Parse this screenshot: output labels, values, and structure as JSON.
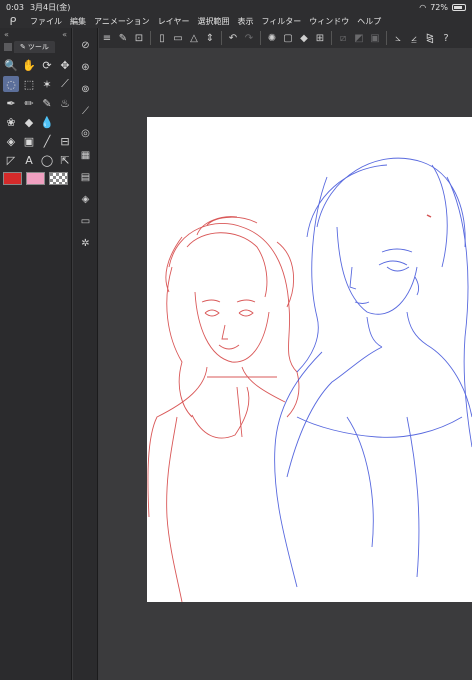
{
  "status_bar": {
    "time": "0:03",
    "date": "3月4日(金)",
    "wifi_icon": "wifi-icon",
    "battery": "72%"
  },
  "menu": {
    "logo_icon": "clip-studio-logo-icon",
    "items": [
      "ファイル",
      "編集",
      "アニメーション",
      "レイヤー",
      "選択範囲",
      "表示",
      "フィルター",
      "ウィンドウ",
      "ヘルプ"
    ]
  },
  "tool_panel": {
    "collapse_left": "«",
    "collapse_right": "«",
    "tab_label": "ツール",
    "tools": [
      {
        "name": "zoom",
        "glyph": "🔍"
      },
      {
        "name": "hand",
        "glyph": "✋"
      },
      {
        "name": "rotate",
        "glyph": "⟳"
      },
      {
        "name": "move",
        "glyph": "✥"
      },
      {
        "name": "lasso",
        "glyph": "◌",
        "selected": true
      },
      {
        "name": "select",
        "glyph": "⬚"
      },
      {
        "name": "magic-wand",
        "glyph": "✶"
      },
      {
        "name": "eyedropper",
        "glyph": "⟋"
      },
      {
        "name": "pen",
        "glyph": "✒"
      },
      {
        "name": "pencil",
        "glyph": "✏"
      },
      {
        "name": "brush",
        "glyph": "✎"
      },
      {
        "name": "airbrush",
        "glyph": "♨"
      },
      {
        "name": "decoration",
        "glyph": "❀"
      },
      {
        "name": "eraser",
        "glyph": "◆"
      },
      {
        "name": "blend",
        "glyph": "💧"
      },
      {
        "name": "spacer",
        "glyph": ""
      },
      {
        "name": "fill",
        "glyph": "◈"
      },
      {
        "name": "gradient",
        "glyph": "▣"
      },
      {
        "name": "line",
        "glyph": "╱"
      },
      {
        "name": "frame",
        "glyph": "⊟"
      },
      {
        "name": "ruler",
        "glyph": "◸"
      },
      {
        "name": "text",
        "glyph": "A"
      },
      {
        "name": "balloon",
        "glyph": "◯"
      },
      {
        "name": "object",
        "glyph": "⇱"
      }
    ],
    "colors": {
      "main": "#d42a2a",
      "sub": "#f0a0c0"
    }
  },
  "side_icons": [
    "navigator-icon",
    "sub-tool-icon",
    "tool-property-icon",
    "brush-size-icon",
    "color-wheel-icon",
    "color-set-icon",
    "layer-property-icon",
    "layer-icon",
    "material-icon",
    "auto-action-icon"
  ],
  "toolbar": {
    "items": [
      "menu-icon",
      "new-icon",
      "screenshot-icon",
      "file-new-icon",
      "open-icon",
      "save-icon",
      "stepper-icon",
      "undo-icon",
      "redo-icon",
      "loading-icon",
      "clear-icon",
      "fill-icon",
      "transform-icon",
      "deselect-icon",
      "invert-icon",
      "crop-icon",
      "ruler-edit-icon",
      "ruler-snap-icon",
      "special-ruler-icon",
      "help-icon"
    ]
  }
}
